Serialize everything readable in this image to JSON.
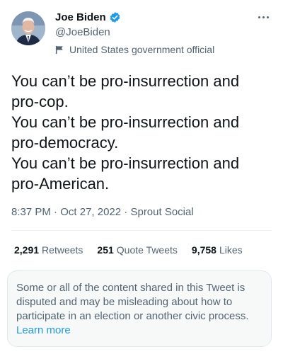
{
  "author": {
    "name": "Joe Biden",
    "handle": "@JoeBiden",
    "label": "United States government official",
    "verified_color": "#1d9bf0"
  },
  "tweet": {
    "lines": [
      "You can’t be pro-insurrection and",
      "pro-cop.",
      "You can’t be pro-insurrection and",
      "pro-democracy.",
      "You can’t be pro-insurrection and",
      "pro-American."
    ],
    "time": "8:37 PM",
    "date": "Oct 27, 2022",
    "source": "Sprout Social",
    "separator": "·"
  },
  "stats": [
    {
      "count": "2,291",
      "label": "Retweets"
    },
    {
      "count": "251",
      "label": "Quote Tweets"
    },
    {
      "count": "9,758",
      "label": "Likes"
    }
  ],
  "notice": {
    "text": "Some or all of the content shared in this Tweet is disputed and may be misleading about how to participate in an election or another civic process.",
    "link": "Learn more"
  },
  "colors": {
    "accent": "#1d9bf0",
    "muted": "#536471",
    "text": "#0f1419"
  }
}
